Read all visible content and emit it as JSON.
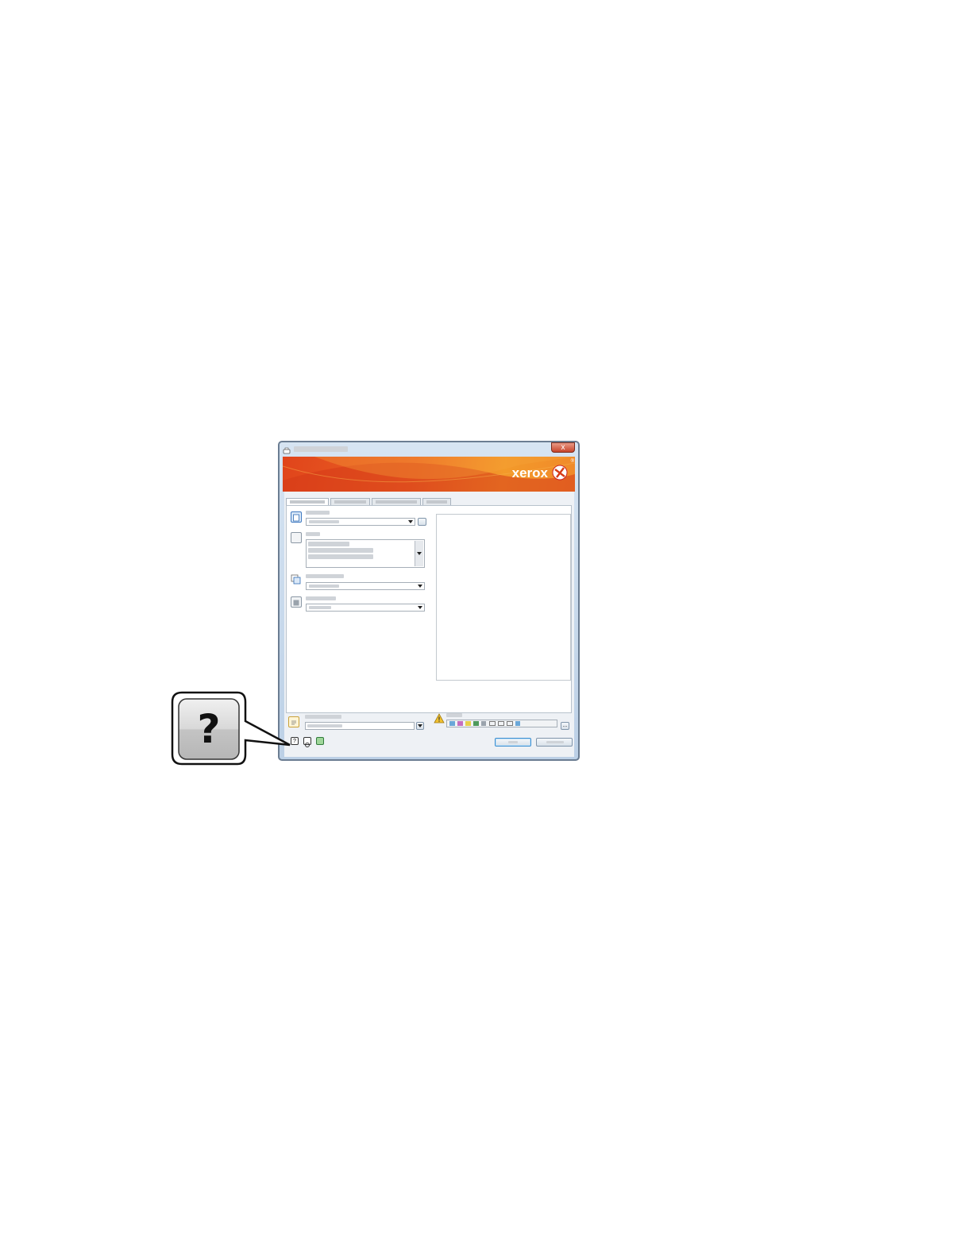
{
  "window": {
    "title": "",
    "close_label": "x",
    "brand": {
      "logo_text": "xerox",
      "registered_mark": "®",
      "accent": "#e8531f"
    },
    "tabs": [
      {
        "label": ""
      },
      {
        "label": ""
      },
      {
        "label": ""
      },
      {
        "label": ""
      }
    ],
    "settings": [
      {
        "icon": "paper-icon",
        "label": "",
        "value": ""
      },
      {
        "icon": "blank-page-icon",
        "label": "",
        "options": [
          "",
          "",
          ""
        ]
      },
      {
        "icon": "copies-icon",
        "label": "",
        "value": ""
      },
      {
        "icon": "quality-icon",
        "label": "",
        "value": ""
      }
    ],
    "footer": {
      "saved_settings_label": "",
      "saved_settings_value": "",
      "status_label": "",
      "more_label": "...",
      "ok_label": "",
      "cancel_label": ""
    },
    "help_icon_glyph": "?"
  },
  "callout": {
    "glyph": "?"
  }
}
